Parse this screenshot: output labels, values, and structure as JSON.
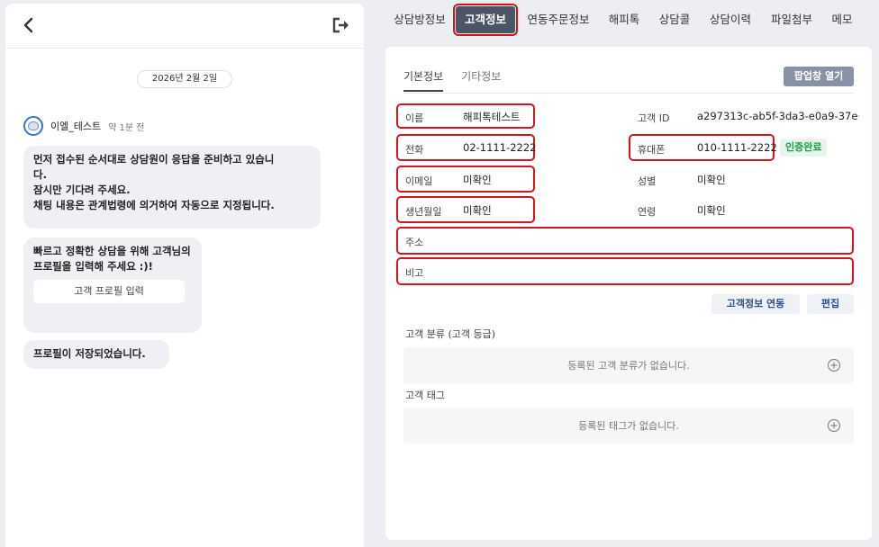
{
  "chat": {
    "date": "2026년 2월 2일",
    "sender_name": "이엘_테스트",
    "sender_time": "약 1분 전",
    "message1_lines": [
      "먼저 접수된 순서대로 상담원이 응답을 준비하고 있습니",
      "다.",
      "잠시만 기다려 주세요.",
      "채팅 내용은 관계법령에 의거하여 자동으로 지정됩니다."
    ],
    "message2": "빠르고 정확한 상담을 위해 고객님의 프로필을 입력해 주세요 :)!",
    "profile_button": "고객 프로필 입력",
    "message3": "프로필이 저장되었습니다."
  },
  "tabs": [
    "상담방정보",
    "고객정보",
    "연동주문정보",
    "해피톡",
    "상담콜",
    "상담이력",
    "파일첨부",
    "메모"
  ],
  "active_tab": "고객정보",
  "customer": {
    "subtabs": [
      "기본정보",
      "기타정보"
    ],
    "popup_button": "팝업창 열기",
    "fields": {
      "name_label": "이름",
      "name_value": "해피톡테스트",
      "id_label": "고객 ID",
      "id_value": "a297313c-ab5f-3da3-e0a9-37e···",
      "phone_label": "전화",
      "phone_value": "02-1111-2222",
      "mobile_label": "휴대폰",
      "mobile_value": "010-1111-2222",
      "verified": "인증완료",
      "email_label": "이메일",
      "email_value": "미확인",
      "gender_label": "성별",
      "gender_value": "미확인",
      "birth_label": "생년월일",
      "birth_value": "미확인",
      "age_label": "연령",
      "age_value": "미확인",
      "address_label": "주소",
      "note_label": "비고"
    },
    "link_button": "고객정보 연동",
    "edit_button": "편집",
    "category_label": "고객 분류 (고객 등급)",
    "category_empty": "등록된 고객 분류가 없습니다.",
    "tag_label": "고객 태그",
    "tag_empty": "등록된 태그가 없습니다."
  },
  "colors": {
    "highlight": "#d0161c",
    "active_tab_bg": "#4b5566",
    "verified": "#1e9c4a"
  }
}
